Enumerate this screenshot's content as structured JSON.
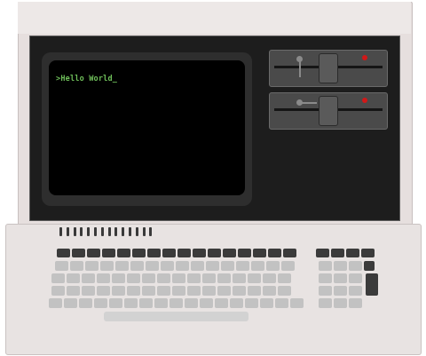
{
  "screen": {
    "text": ">Hello World_"
  },
  "colors": {
    "housing": "#e6dfde",
    "bezel": "#1d1d1d",
    "screen_bg": "#000000",
    "screen_text": "#6fbf5a",
    "drive_led": "#d11818",
    "dark_key": "#3b3b3b",
    "light_key": "#c2c2c2"
  }
}
